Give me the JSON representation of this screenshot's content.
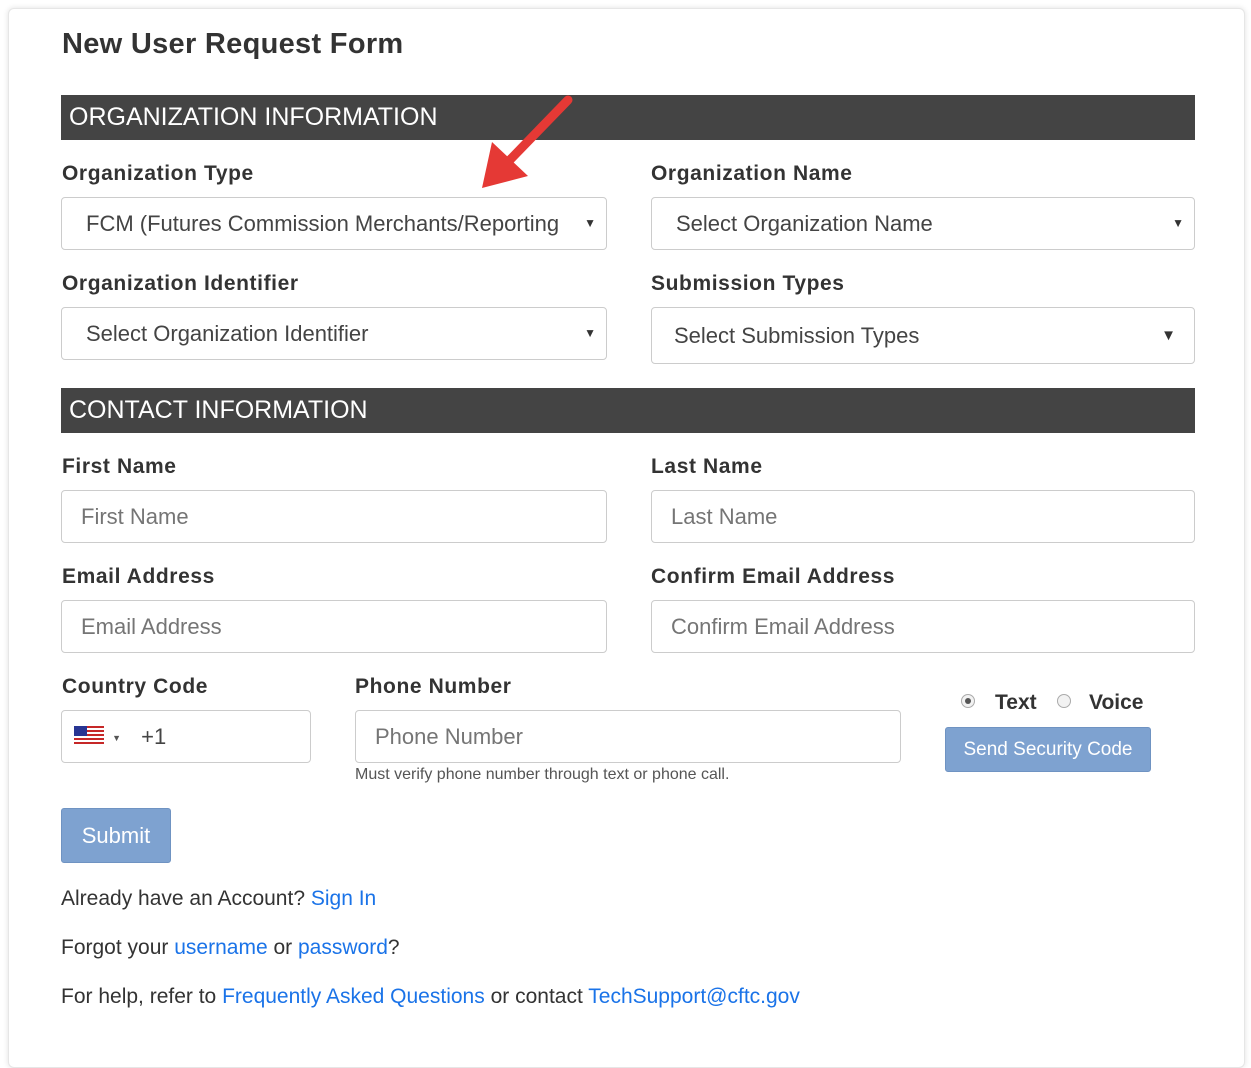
{
  "form": {
    "title": "New User Request Form"
  },
  "sections": {
    "organization": "ORGANIZATION INFORMATION",
    "contact": "CONTACT INFORMATION"
  },
  "org": {
    "type_label": "Organization Type",
    "type_value": "FCM (Futures Commission Merchants/Reporting Firms)",
    "name_label": "Organization Name",
    "name_value": "Select Organization Name",
    "identifier_label": "Organization Identifier",
    "identifier_value": "Select Organization Identifier",
    "submission_label": "Submission Types",
    "submission_value": "Select Submission Types"
  },
  "contact": {
    "first_name_label": "First Name",
    "first_name_placeholder": "First Name",
    "last_name_label": "Last Name",
    "last_name_placeholder": "Last Name",
    "email_label": "Email Address",
    "email_placeholder": "Email Address",
    "confirm_email_label": "Confirm Email Address",
    "confirm_email_placeholder": "Confirm Email Address",
    "country_code_label": "Country Code",
    "country_code_value": "+1",
    "phone_label": "Phone Number",
    "phone_placeholder": "Phone Number",
    "phone_help": "Must verify phone number through text or phone call.",
    "radio_text": "Text",
    "radio_voice": "Voice",
    "send_code_label": "Send Security Code"
  },
  "actions": {
    "submit_label": "Submit"
  },
  "footer": {
    "account_prefix": "Already have an Account?",
    "sign_in": "Sign In",
    "forgot_prefix": "Forgot your",
    "username": "username",
    "or": "or",
    "password": "password",
    "question_mark": "?",
    "help_prefix": "For help, refer to",
    "faq": "Frequently Asked Questions",
    "or_contact": "or contact",
    "email": "TechSupport@cftc.gov"
  },
  "colors": {
    "section_bar": "#444444",
    "button": "#7ea2d0",
    "link": "#1a73e8",
    "arrow": "#e53935"
  },
  "icons": {
    "flag": "us-flag-icon",
    "arrow": "red-arrow-annotation"
  }
}
